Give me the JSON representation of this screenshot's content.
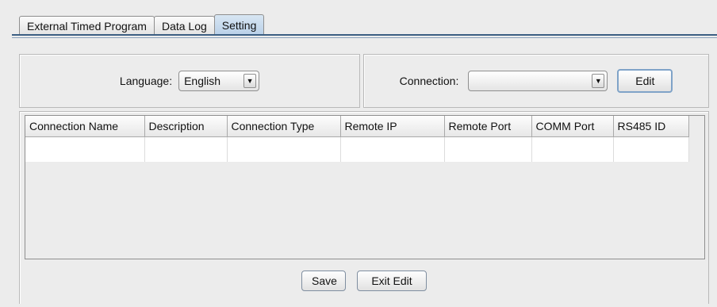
{
  "tabs": [
    {
      "label": "External Timed Program",
      "active": false
    },
    {
      "label": "Data Log",
      "active": false
    },
    {
      "label": "Setting",
      "active": true
    }
  ],
  "language": {
    "label": "Language:",
    "selected": "English"
  },
  "connection": {
    "label": "Connection:",
    "selected": "",
    "edit_label": "Edit"
  },
  "table": {
    "columns": [
      "Connection Name",
      "Description",
      "Connection Type",
      "Remote IP",
      "Remote Port",
      "COMM Port",
      "RS485 ID"
    ],
    "rows": [
      [
        "",
        "",
        "",
        "",
        "",
        "",
        ""
      ]
    ]
  },
  "actions": {
    "save_label": "Save",
    "exit_edit_label": "Exit Edit"
  },
  "icons": {
    "dropdown_arrow": "chevron-down-icon",
    "glyph": "▼"
  },
  "colors": {
    "active_tab": "#b9d0e8",
    "tab_border_line": "#3c5f83"
  }
}
